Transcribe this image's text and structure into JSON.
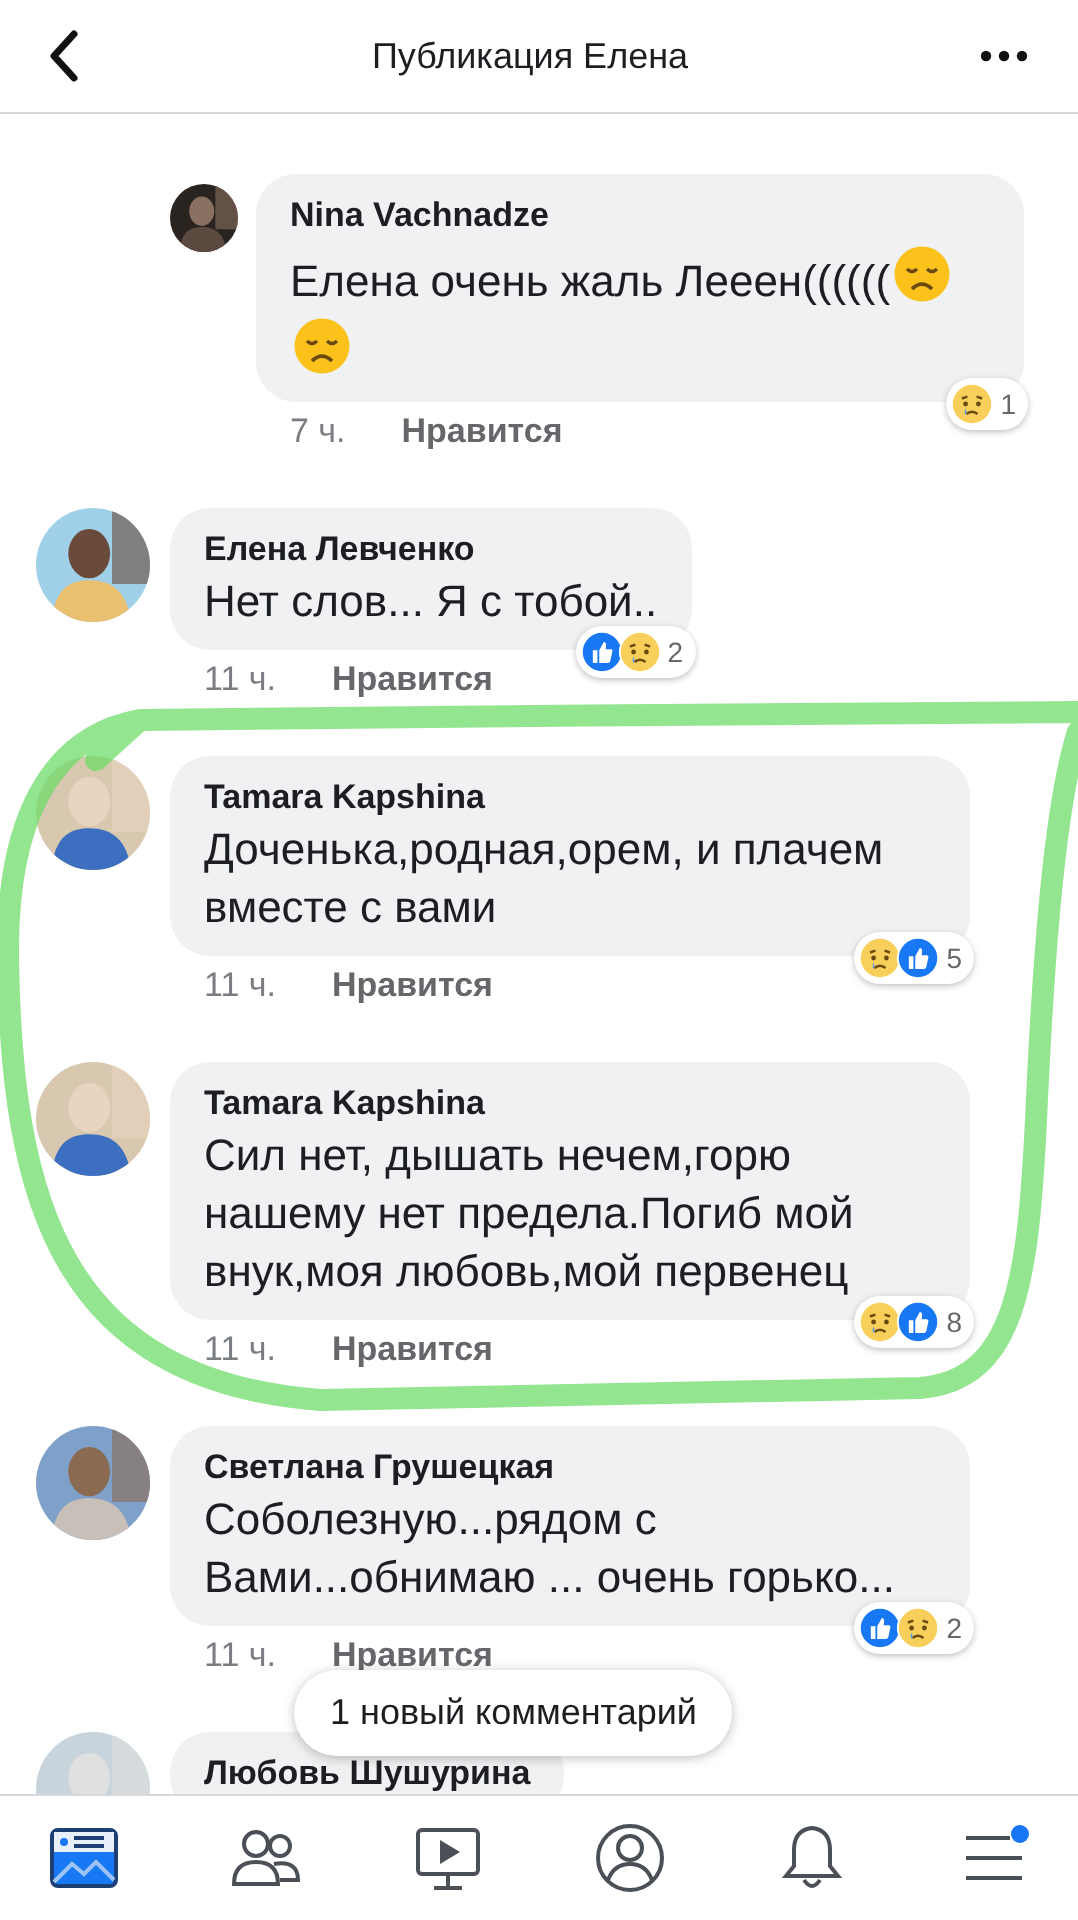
{
  "header": {
    "title": "Публикация Елена"
  },
  "comments": [
    {
      "author": "Nina Vachnadze",
      "text": "Елена очень жаль Лееен((((((",
      "emoji": [
        {
          "kind": "disappointed"
        },
        {
          "kind": "disappointed"
        }
      ],
      "reply": true,
      "time": "7 ч.",
      "like_label": "Нравится",
      "reactions": [
        {
          "kind": "sad"
        }
      ],
      "reaction_count": "1"
    },
    {
      "author": "Елена Левченко",
      "text": "Нет слов... Я с тобой..",
      "reply": false,
      "time": "11 ч.",
      "like_label": "Нравится",
      "reactions": [
        {
          "kind": "like"
        },
        {
          "kind": "sad"
        }
      ],
      "reaction_count": "2"
    },
    {
      "author": "Tamara Kapshina",
      "text": "Доченька,родная,орем, и плачем вместе с вами",
      "reply": false,
      "time": "11 ч.",
      "like_label": "Нравится",
      "reactions": [
        {
          "kind": "sad"
        },
        {
          "kind": "like"
        }
      ],
      "reaction_count": "5"
    },
    {
      "author": "Tamara Kapshina",
      "text": "Сил нет, дышать нечем,горю нашему нет предела.Погиб мой внук,моя любовь,мой первенец",
      "reply": false,
      "time": "11 ч.",
      "like_label": "Нравится",
      "reactions": [
        {
          "kind": "sad"
        },
        {
          "kind": "like"
        }
      ],
      "reaction_count": "8"
    },
    {
      "author": "Светлана Грушецкая",
      "text": "Соболезную...рядом с Вами...обнимаю ... очень горько...",
      "reply": false,
      "time": "11 ч.",
      "like_label": "Нравится",
      "reactions": [
        {
          "kind": "like"
        },
        {
          "kind": "sad"
        }
      ],
      "reaction_count": "2"
    },
    {
      "author": "Любовь Шушурина",
      "reply": false
    }
  ],
  "toast": "1 новый комментарий",
  "nav": [
    {
      "kind": "feed",
      "selected": true
    },
    {
      "kind": "friends",
      "selected": false
    },
    {
      "kind": "video",
      "selected": false
    },
    {
      "kind": "profile",
      "selected": false
    },
    {
      "kind": "bell",
      "selected": false
    },
    {
      "kind": "menu",
      "selected": false,
      "dot": true
    }
  ]
}
